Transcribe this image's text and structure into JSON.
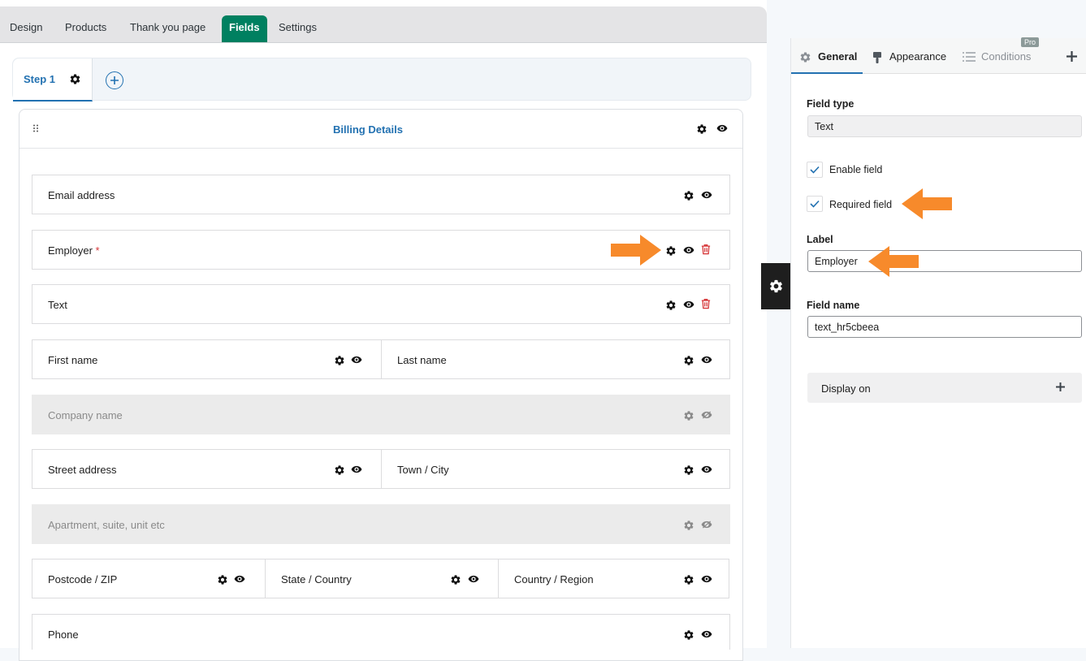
{
  "top_tabs": [
    "Design",
    "Products",
    "Thank you page",
    "Fields",
    "Settings"
  ],
  "active_tab": "Fields",
  "steps": {
    "step1_label": "Step 1"
  },
  "section": {
    "title": "Billing Details"
  },
  "fields": {
    "email": "Email address",
    "employer": "Employer",
    "required_mark": "*",
    "text": "Text",
    "first_name": "First name",
    "last_name": "Last name",
    "company": "Company name",
    "street": "Street address",
    "town": "Town / City",
    "apartment": "Apartment, suite, unit etc",
    "postcode": "Postcode / ZIP",
    "state": "State / Country",
    "country": "Country / Region",
    "phone": "Phone"
  },
  "panel": {
    "tabs": {
      "general": "General",
      "appearance": "Appearance",
      "conditions": "Conditions",
      "pro_badge": "Pro"
    },
    "field_type_label": "Field type",
    "field_type_value": "Text",
    "enable_field": "Enable field",
    "required_field": "Required field",
    "label_label": "Label",
    "label_value": "Employer",
    "field_name_label": "Field name",
    "field_name_value": "text_hr5cbeea",
    "display_on": "Display on"
  },
  "colors": {
    "accent_green": "#008060",
    "link_blue": "#2271b1",
    "annotation_orange": "#f78a2b",
    "delete_red": "#d63638"
  },
  "icons": [
    "gear-icon",
    "eye-icon",
    "eye-slash-icon",
    "trash-icon",
    "plus-icon",
    "drag-handle-icon",
    "check-icon",
    "brush-icon",
    "list-icon",
    "arrow-annotation"
  ]
}
